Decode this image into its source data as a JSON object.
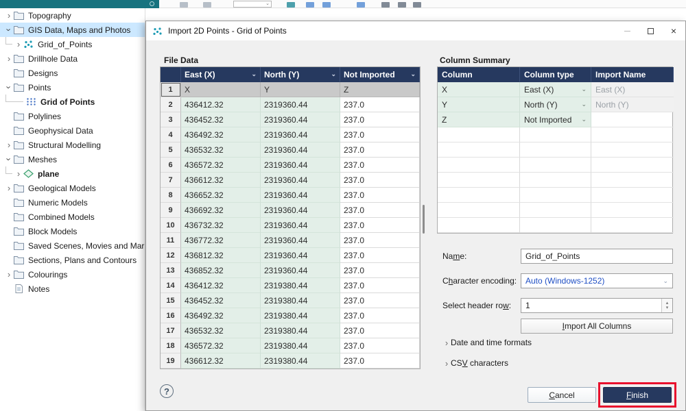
{
  "colors": {
    "navy": "#26395f",
    "green": "#e3efe8",
    "selected": "#cce8ff",
    "teal": "#17737f",
    "annotation": "#e8112d",
    "link": "#1f4fc4"
  },
  "icons": {
    "close": "×",
    "chevron_down": "⌄",
    "chevron_right": "›",
    "spin_up": "▴",
    "spin_down": "▾"
  },
  "sidebar": {
    "items": [
      {
        "label": "Topography",
        "icon": "folder",
        "chevron": "right",
        "indent": 0
      },
      {
        "label": "GIS Data, Maps and Photos",
        "icon": "folder",
        "chevron": "down",
        "indent": 0,
        "selected": true
      },
      {
        "label": "Grid_of_Points",
        "icon": "gis-points",
        "chevron": "right",
        "indent": 1
      },
      {
        "label": "Drillhole Data",
        "icon": "folder",
        "chevron": "right",
        "indent": 0
      },
      {
        "label": "Designs",
        "icon": "folder",
        "chevron": null,
        "indent": 0
      },
      {
        "label": "Points",
        "icon": "folder",
        "chevron": "down",
        "indent": 0
      },
      {
        "label": "Grid of Points",
        "icon": "grid-points",
        "chevron": null,
        "indent": 1,
        "bold": true
      },
      {
        "label": "Polylines",
        "icon": "folder",
        "chevron": null,
        "indent": 0
      },
      {
        "label": "Geophysical Data",
        "icon": "folder",
        "chevron": null,
        "indent": 0
      },
      {
        "label": "Structural Modelling",
        "icon": "folder",
        "chevron": "right",
        "indent": 0
      },
      {
        "label": "Meshes",
        "icon": "folder",
        "chevron": "down",
        "indent": 0
      },
      {
        "label": "plane",
        "icon": "plane",
        "chevron": "right",
        "indent": 1,
        "bold": true
      },
      {
        "label": "Geological Models",
        "icon": "folder",
        "chevron": "right",
        "indent": 0
      },
      {
        "label": "Numeric Models",
        "icon": "folder",
        "chevron": null,
        "indent": 0
      },
      {
        "label": "Combined Models",
        "icon": "folder",
        "chevron": null,
        "indent": 0
      },
      {
        "label": "Block Models",
        "icon": "folder",
        "chevron": null,
        "indent": 0
      },
      {
        "label": "Saved Scenes, Movies and Marke",
        "icon": "folder",
        "chevron": null,
        "indent": 0
      },
      {
        "label": "Sections, Plans and Contours",
        "icon": "folder",
        "chevron": null,
        "indent": 0
      },
      {
        "label": "Colourings",
        "icon": "folder",
        "chevron": "right",
        "indent": 0
      },
      {
        "label": "Notes",
        "icon": "notes",
        "chevron": null,
        "indent": 0
      }
    ]
  },
  "dialog": {
    "title": "Import 2D Points - Grid of Points",
    "file_data": {
      "label": "File Data",
      "columns": [
        "East (X)",
        "North (Y)",
        "Not Imported"
      ],
      "rows": [
        [
          "1",
          "X",
          "Y",
          "Z"
        ],
        [
          "2",
          "436412.32",
          "2319360.44",
          "237.0"
        ],
        [
          "3",
          "436452.32",
          "2319360.44",
          "237.0"
        ],
        [
          "4",
          "436492.32",
          "2319360.44",
          "237.0"
        ],
        [
          "5",
          "436532.32",
          "2319360.44",
          "237.0"
        ],
        [
          "6",
          "436572.32",
          "2319360.44",
          "237.0"
        ],
        [
          "7",
          "436612.32",
          "2319360.44",
          "237.0"
        ],
        [
          "8",
          "436652.32",
          "2319360.44",
          "237.0"
        ],
        [
          "9",
          "436692.32",
          "2319360.44",
          "237.0"
        ],
        [
          "10",
          "436732.32",
          "2319360.44",
          "237.0"
        ],
        [
          "11",
          "436772.32",
          "2319360.44",
          "237.0"
        ],
        [
          "12",
          "436812.32",
          "2319360.44",
          "237.0"
        ],
        [
          "13",
          "436852.32",
          "2319360.44",
          "237.0"
        ],
        [
          "14",
          "436412.32",
          "2319380.44",
          "237.0"
        ],
        [
          "15",
          "436452.32",
          "2319380.44",
          "237.0"
        ],
        [
          "16",
          "436492.32",
          "2319380.44",
          "237.0"
        ],
        [
          "17",
          "436532.32",
          "2319380.44",
          "237.0"
        ],
        [
          "18",
          "436572.32",
          "2319380.44",
          "237.0"
        ],
        [
          "19",
          "436612.32",
          "2319380.44",
          "237.0"
        ]
      ]
    },
    "column_summary": {
      "label": "Column Summary",
      "columns": [
        "Column",
        "Column type",
        "Import Name"
      ],
      "rows": [
        {
          "column": "X",
          "type": "East (X)",
          "import_name": "East (X)",
          "import_disabled": true
        },
        {
          "column": "Y",
          "type": "North (Y)",
          "import_name": "North (Y)",
          "import_disabled": true
        },
        {
          "column": "Z",
          "type": "Not Imported",
          "import_name": "",
          "import_disabled": false
        }
      ],
      "empty_rows": 7
    },
    "form": {
      "name_label": "Name:",
      "name_mnemonic": "m",
      "name_value": "Grid_of_Points",
      "encoding_label": "Character encoding:",
      "encoding_mnemonic": "h",
      "encoding_value": "Auto (Windows-1252)",
      "header_row_label": "Select header row:",
      "header_row_mnemonic": "w",
      "header_row_value": "1",
      "import_all_label": "Import All Columns",
      "import_all_mnemonic": "I",
      "date_formats_label": "Date and time formats",
      "csv_label": "CSV characters",
      "csv_mnemonic": "V"
    },
    "footer": {
      "help": "?",
      "cancel_label": "Cancel",
      "cancel_mnemonic": "C",
      "finish_label": "Finish",
      "finish_mnemonic": "F"
    }
  }
}
